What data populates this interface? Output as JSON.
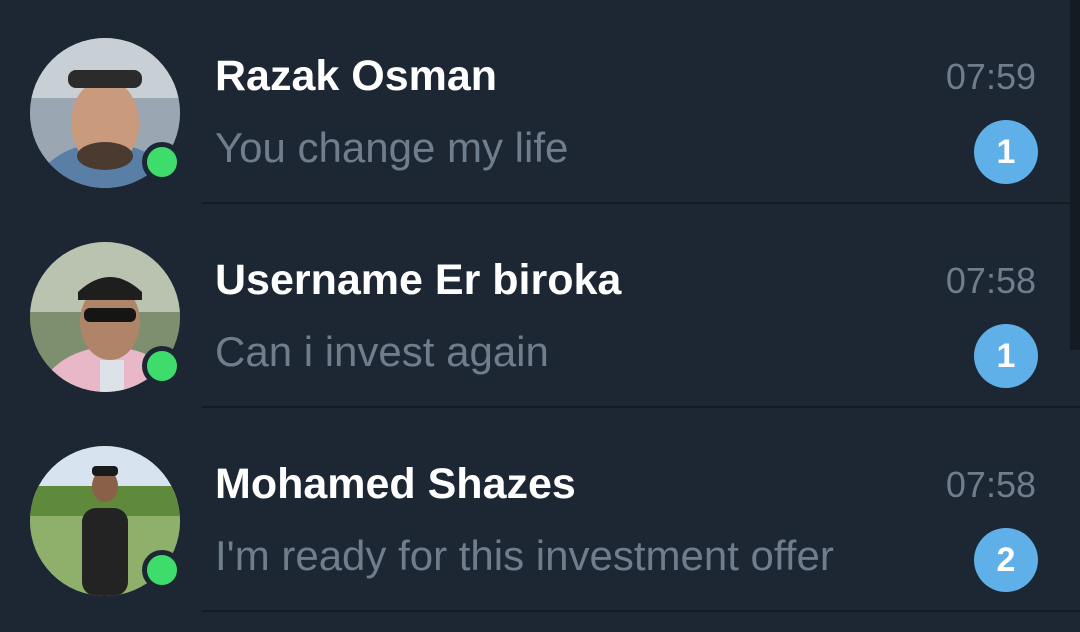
{
  "chats": [
    {
      "name": "Razak Osman",
      "time": "07:59",
      "preview": "You change my life",
      "unread": "1",
      "online": true
    },
    {
      "name": "Username Er biroka",
      "time": "07:58",
      "preview": "Can i invest again",
      "unread": "1",
      "online": true
    },
    {
      "name": "Mohamed Shazes",
      "time": "07:58",
      "preview": "I'm ready for this investment offer",
      "unread": "2",
      "online": true
    }
  ],
  "colors": {
    "background": "#1d2733",
    "name": "#ffffff",
    "secondary_text": "#6f7d8c",
    "badge": "#5fb0e8",
    "online": "#3ddc6b"
  }
}
